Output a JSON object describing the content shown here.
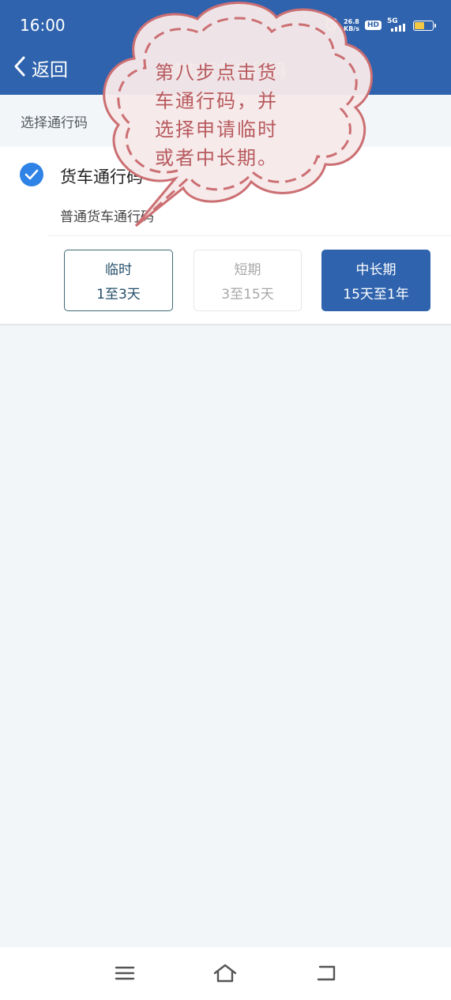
{
  "status_bar": {
    "time": "16:00",
    "net_speed_value": "26.8",
    "net_speed_unit": "KB/s",
    "hd_badge": "HD",
    "network": "5G",
    "icons": [
      "alarm-icon",
      "signal-icon",
      "battery-icon"
    ]
  },
  "header": {
    "back_label": "返回",
    "title": "城市货车通行码"
  },
  "section": {
    "label": "选择通行码"
  },
  "pass": {
    "title": "货车通行码",
    "subtitle": "普通货车通行码",
    "selected": true
  },
  "options": [
    {
      "name": "临时",
      "range": "1至3天",
      "state": "outlined"
    },
    {
      "name": "短期",
      "range": "3至15天",
      "state": "disabled"
    },
    {
      "name": "中长期",
      "range": "15天至1年",
      "state": "selected"
    }
  ],
  "annotation": {
    "line1": "第八步点击货",
    "line2": "车通行码，并",
    "line3": "选择申请临时",
    "line4": "或者中长期。",
    "color": "#b85a5e"
  },
  "nav_bar": {
    "icons": [
      "menu-icon",
      "home-icon",
      "back-icon"
    ]
  },
  "colors": {
    "brand_blue": "#2f63ad",
    "check_blue": "#2f83e6",
    "background": "#f3f6f9"
  }
}
